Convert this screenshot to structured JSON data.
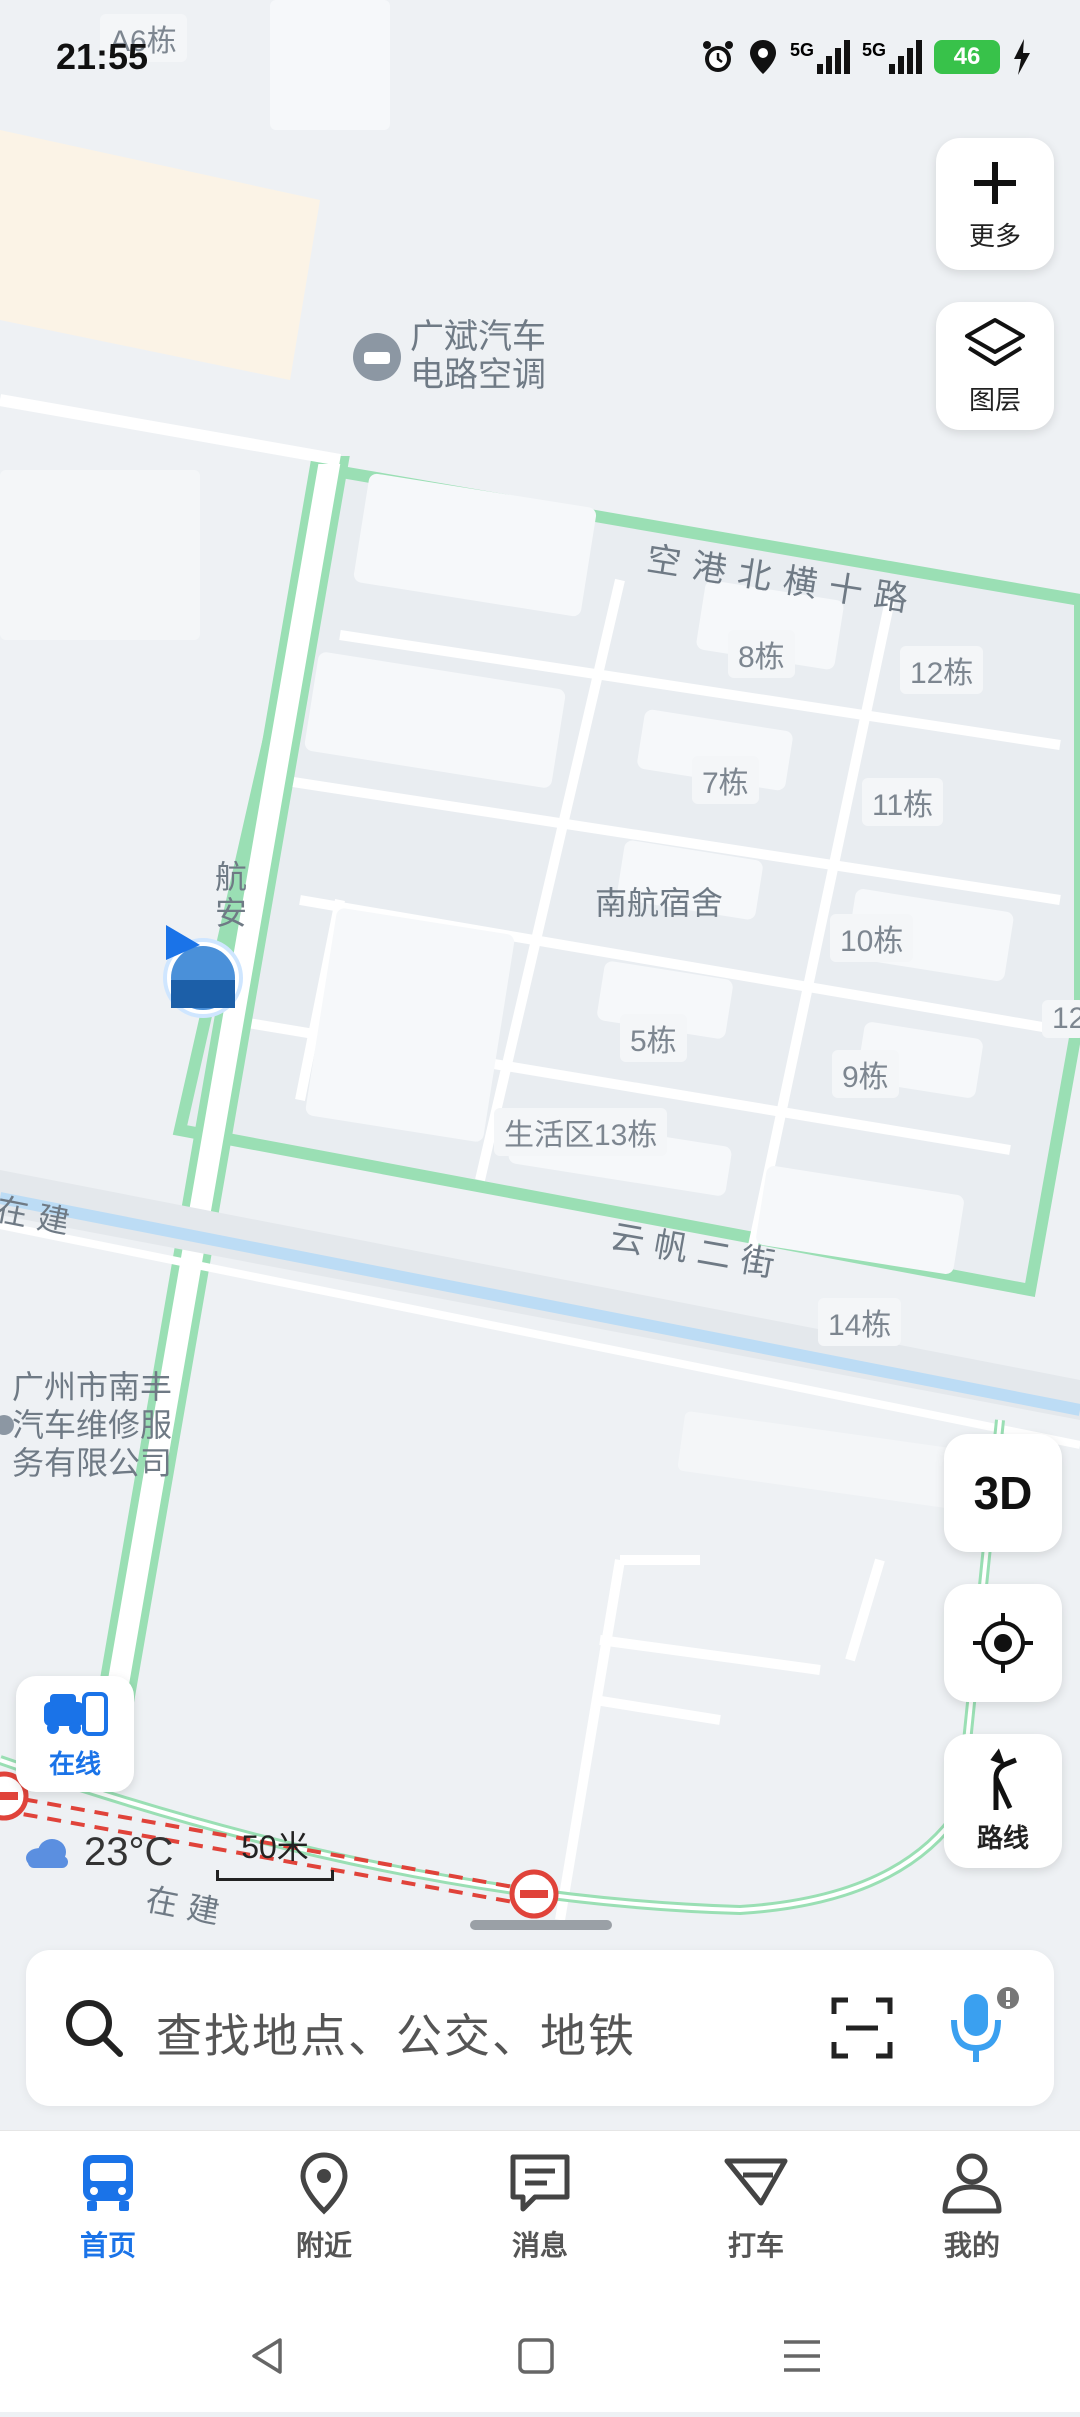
{
  "status_bar": {
    "time": "21:55",
    "icons": [
      "alarm-icon",
      "location-pin-icon",
      "signal-5g-icon",
      "signal-5g-icon",
      "charging-icon"
    ],
    "network_1": "5G",
    "network_2": "5G",
    "battery_level": "46"
  },
  "map": {
    "pois": [
      {
        "label": "广斌汽车",
        "label2": "电路空调"
      },
      {
        "label": "广州市南丰",
        "label2": "汽车维修服",
        "label3": "务有限公司"
      }
    ],
    "roads": [
      "空港北横十路",
      "云帆二街",
      "航安",
      "在建",
      "在建"
    ],
    "buildings": [
      "A6栋",
      "8栋",
      "12栋",
      "7栋",
      "11栋",
      "10栋",
      "5栋",
      "9栋",
      "生活区13栋",
      "14栋",
      "12"
    ],
    "area_name": "南航宿舍",
    "weather": {
      "temperature": "23°C",
      "icon": "cloud-icon"
    },
    "scale": "50米"
  },
  "right_controls": {
    "more_label": "更多",
    "layers_label": "图层",
    "view_3d_label": "3D",
    "route_label": "路线"
  },
  "online_badge": {
    "label": "在线"
  },
  "search": {
    "placeholder": "查找地点、公交、地铁"
  },
  "tabs": [
    {
      "label": "首页",
      "icon": "bus-icon",
      "active": true
    },
    {
      "label": "附近",
      "icon": "location-pin-icon",
      "active": false
    },
    {
      "label": "消息",
      "icon": "message-icon",
      "active": false
    },
    {
      "label": "打车",
      "icon": "taxi-icon",
      "active": false
    },
    {
      "label": "我的",
      "icon": "user-icon",
      "active": false
    }
  ],
  "colors": {
    "accent": "#1a73e8",
    "road_border": "#9adfb4",
    "water": "#bcdcf5"
  }
}
